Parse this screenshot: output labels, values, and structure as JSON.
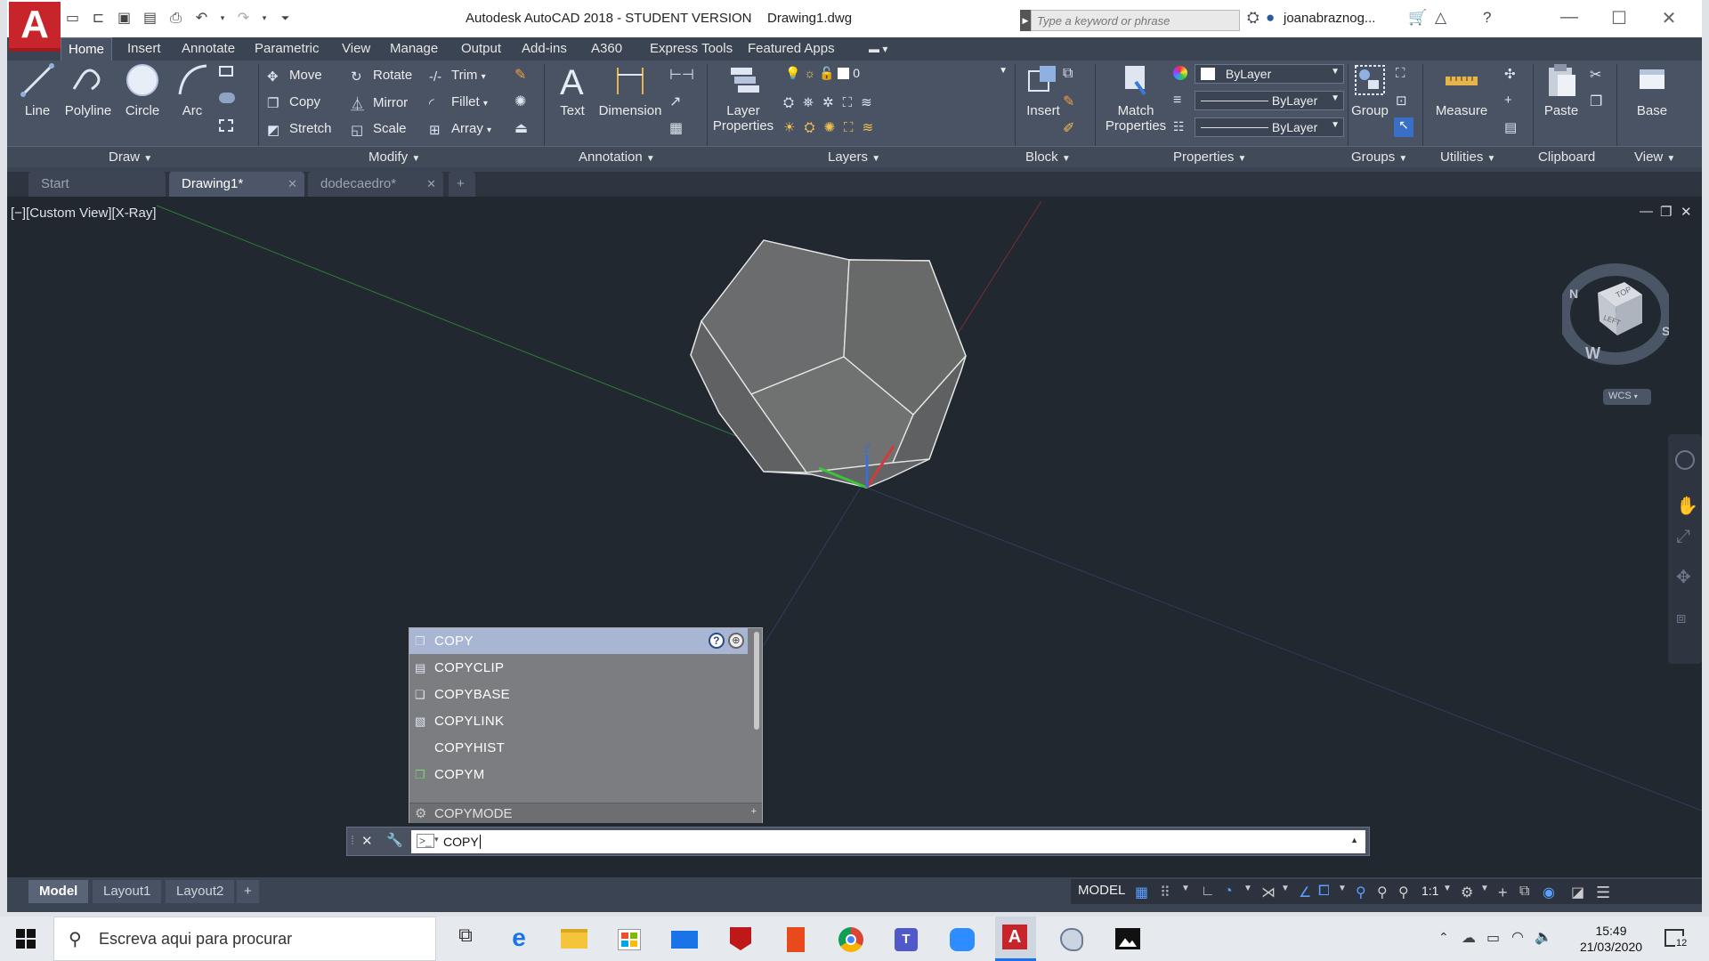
{
  "window": {
    "logo": "A",
    "title": "Autodesk AutoCAD 2018 - STUDENT VERSION",
    "file": "Drawing1.dwg",
    "search_placeholder": "Type a keyword or phrase",
    "user": "joanabraznog...",
    "controls": {
      "minimize": "—",
      "maximize": "☐",
      "close": "✕"
    }
  },
  "ribbon_tabs": [
    "Home",
    "Insert",
    "Annotate",
    "Parametric",
    "View",
    "Manage",
    "Output",
    "Add-ins",
    "A360",
    "Express Tools",
    "Featured Apps"
  ],
  "ribbon": {
    "draw": {
      "line": "Line",
      "polyline": "Polyline",
      "circle": "Circle",
      "arc": "Arc"
    },
    "modify": {
      "move": "Move",
      "rotate": "Rotate",
      "trim": "Trim",
      "copy": "Copy",
      "mirror": "Mirror",
      "fillet": "Fillet",
      "stretch": "Stretch",
      "scale": "Scale",
      "array": "Array"
    },
    "annotation": {
      "text": "Text",
      "dimension": "Dimension"
    },
    "layers": {
      "layer_properties_1": "Layer",
      "layer_properties_2": "Properties",
      "current_layer": "0"
    },
    "block": {
      "insert": "Insert"
    },
    "properties": {
      "match_1": "Match",
      "match_2": "Properties",
      "color": "ByLayer",
      "linetype": "ByLayer",
      "lineweight": "ByLayer"
    },
    "groups": {
      "group": "Group"
    },
    "utilities": {
      "measure": "Measure"
    },
    "clipboard": {
      "paste": "Paste"
    },
    "view": {
      "base": "Base"
    }
  },
  "panel_titles": [
    "Draw",
    "Modify",
    "Annotation",
    "Layers",
    "Block",
    "Properties",
    "Groups",
    "Utilities",
    "Clipboard",
    "View"
  ],
  "doc_tabs": [
    "Start",
    "Drawing1*",
    "dodecaedro*",
    "+"
  ],
  "viewport": {
    "label": "[−][Custom View][X-Ray]",
    "wcs": "WCS",
    "compass": {
      "n": "N",
      "s": "S",
      "w": "W"
    },
    "cube": {
      "top": "TOP",
      "left": "LEFT"
    },
    "axis_z": "Z"
  },
  "autocomplete": {
    "items": [
      "COPY",
      "COPYCLIP",
      "COPYBASE",
      "COPYLINK",
      "COPYHIST",
      "COPYM"
    ],
    "footer": "COPYMODE",
    "selected_index": 0
  },
  "command_line": {
    "value": "COPY"
  },
  "layout_tabs": [
    "Model",
    "Layout1",
    "Layout2",
    "+"
  ],
  "status": {
    "model": "MODEL",
    "scale": "1:1"
  },
  "taskbar": {
    "search": "Escreva aqui para procurar",
    "time": "15:49",
    "date": "21/03/2020",
    "notifications": "12"
  },
  "colors": {
    "accent": "#c8242b",
    "viewport": "#212830",
    "ribbon": "#4a5364",
    "autocomplete_selected": "#a8b6d4"
  }
}
